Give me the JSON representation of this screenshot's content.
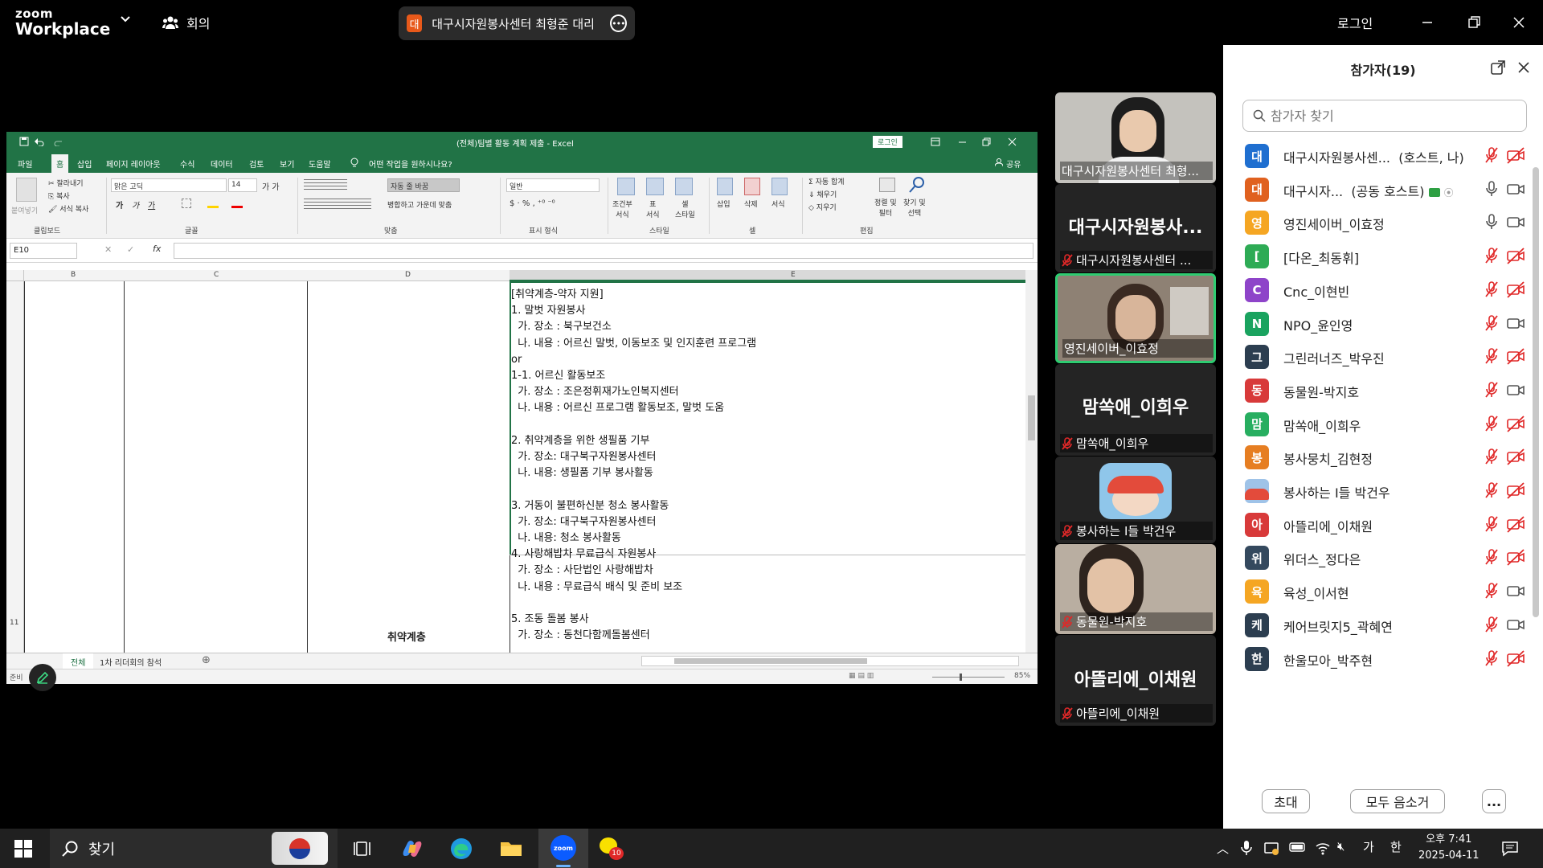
{
  "zoom": {
    "logo_line1": "zoom",
    "logo_line2": "Workplace",
    "meeting_label": "회의",
    "meeting_pill": {
      "avatar_char": "대",
      "title": "대구시자원봉사센터 최형준 대리"
    },
    "login": "로그인"
  },
  "excel": {
    "title": "(전체)팀별 활동 계획 제출  -  Excel",
    "login": "로그인",
    "tabs": [
      "파일",
      "홈",
      "삽입",
      "페이지 레이아웃",
      "수식",
      "데이터",
      "검토",
      "보기",
      "도움말"
    ],
    "tell_me": "어떤 작업을 원하시나요?",
    "share": "공유",
    "ribbon": {
      "clipboard": {
        "paste": "붙여넣기",
        "cut": "잘라내기",
        "copy": "복사",
        "format_painter": "서식 복사",
        "group": "클립보드"
      },
      "font": {
        "name": "맑은 고딕",
        "size": "14",
        "group": "글꼴"
      },
      "align": {
        "wrap": "자동 줄 바꿈",
        "merge": "병합하고 가운데 맞춤",
        "group": "맞춤"
      },
      "number": {
        "format": "일반",
        "group": "표시 형식"
      },
      "styles": {
        "cond": "조건부\n서식",
        "table": "표\n서식",
        "cell": "셀\n스타일",
        "group": "스타일"
      },
      "cells": {
        "insert": "삽입",
        "delete": "삭제",
        "format": "서식",
        "group": "셀"
      },
      "editing": {
        "autosum": "자동 합계",
        "fill": "채우기",
        "clear": "지우기",
        "sort": "정렬 및\n필터",
        "find": "찾기 및\n선택",
        "group": "편집"
      }
    },
    "name_box": "E10",
    "columns": [
      "B",
      "C",
      "D",
      "E"
    ],
    "row_number": "11",
    "cell_d": "취약계층",
    "cell_e": "[취약계층-약자 지원]\n1. 말벗 자원봉사\n  가. 장소 : 북구보건소\n  나. 내용 : 어르신 말벗, 이동보조 및 인지훈련 프로그램\nor\n1-1. 어르신 활동보조\n  가. 장소 : 조은정휘재가노인복지센터\n  나. 내용 : 어르신 프로그램 활동보조, 말벗 도움\n\n2. 취약계층을 위한 생필품 기부\n  가. 장소: 대구북구자원봉사센터\n  나. 내용: 생필품 기부 봉사활동\n\n3. 거동이 불편하신분 청소 봉사활동\n  가. 장소: 대구북구자원봉사센터\n  나. 내용: 청소 봉사활동\n4. 사랑해밥차 무료급식 자원봉사\n  가. 장소 : 사단법인 사랑해밥차\n  나. 내용 : 무료급식 배식 및 준비 보조\n\n5. 조동 돌봄 봉사\n  가. 장소 : 동천다함께돌봄센터",
    "sheets": [
      "전체",
      "1차 리더회의 참석"
    ],
    "status_ready": "준비",
    "zoom_level": "85%"
  },
  "video_tiles": [
    {
      "name": "대구시자원봉사센터 최형...",
      "big": "",
      "muted": false
    },
    {
      "name": "대구시자원봉사센터 ...",
      "big": "대구시자원봉사...",
      "muted": true
    },
    {
      "name": "영진세이버_이효정",
      "big": "",
      "muted": false
    },
    {
      "name": "맘쏙애_이희우",
      "big": "맘쏙애_이희우",
      "muted": true
    },
    {
      "name": "봉사하는 I들 박건우",
      "big": "",
      "muted": true
    },
    {
      "name": "동물원-박지호",
      "big": "",
      "muted": true
    },
    {
      "name": "아뜰리에_이채원",
      "big": "아뜰리에_이채원",
      "muted": true
    }
  ],
  "participants": {
    "title": "참가자(19)",
    "search_placeholder": "참가자 찾기",
    "items": [
      {
        "avatar": "대",
        "color": "#1f6fd0",
        "name": "대구시자원봉사센...",
        "role": "(호스트, 나)",
        "mic": "muted",
        "cam": "off"
      },
      {
        "avatar": "대",
        "color": "#e0611f",
        "name": "대구시자...",
        "role": "(공동 호스트)",
        "mic": "on",
        "cam": "on"
      },
      {
        "avatar": "영",
        "color": "#f5a623",
        "name": "영진세이버_이효정",
        "role": "",
        "mic": "on",
        "cam": "on"
      },
      {
        "avatar": "[",
        "color": "#2eab55",
        "name": "[다온_최동휘]",
        "role": "",
        "mic": "muted",
        "cam": "off"
      },
      {
        "avatar": "C",
        "color": "#8e44c9",
        "name": "Cnc_이현빈",
        "role": "",
        "mic": "muted",
        "cam": "off"
      },
      {
        "avatar": "N",
        "color": "#1aa35f",
        "name": "NPO_윤인영",
        "role": "",
        "mic": "muted",
        "cam": "on"
      },
      {
        "avatar": "그",
        "color": "#2c3e50",
        "name": "그린러너즈_박우진",
        "role": "",
        "mic": "muted",
        "cam": "off"
      },
      {
        "avatar": "동",
        "color": "#d83a3a",
        "name": "동물원-박지호",
        "role": "",
        "mic": "muted",
        "cam": "on"
      },
      {
        "avatar": "맘",
        "color": "#27ae60",
        "name": "맘쏙애_이희우",
        "role": "",
        "mic": "muted",
        "cam": "off"
      },
      {
        "avatar": "봉",
        "color": "#e67e22",
        "name": "봉사뭉치_김현정",
        "role": "",
        "mic": "muted",
        "cam": "off"
      },
      {
        "avatar": "img",
        "color": "#9fc3e8",
        "name": "봉사하는 I들 박건우",
        "role": "",
        "mic": "muted",
        "cam": "off"
      },
      {
        "avatar": "아",
        "color": "#d83a3a",
        "name": "아뜰리에_이채원",
        "role": "",
        "mic": "muted",
        "cam": "off"
      },
      {
        "avatar": "위",
        "color": "#34495e",
        "name": "위더스_정다은",
        "role": "",
        "mic": "muted",
        "cam": "off"
      },
      {
        "avatar": "육",
        "color": "#f5a623",
        "name": "육성_이서현",
        "role": "",
        "mic": "muted",
        "cam": "on"
      },
      {
        "avatar": "케",
        "color": "#2c3e50",
        "name": "케어브릿지5_곽혜연",
        "role": "",
        "mic": "muted",
        "cam": "on"
      },
      {
        "avatar": "한",
        "color": "#2c3e50",
        "name": "한울모아_박주현",
        "role": "",
        "mic": "muted",
        "cam": "off"
      }
    ],
    "invite": "초대",
    "mute_all": "모두 음소거",
    "more": "..."
  },
  "taskbar": {
    "search": "찾기",
    "ime1": "가",
    "ime2": "한",
    "time": "오후 7:41",
    "date": "2025-04-11",
    "chat_badge": "10"
  },
  "colors": {
    "excel_green": "#217346",
    "zoom_blue": "#0b5cff",
    "muted_red": "#e02828",
    "active_green": "#2ecc71"
  }
}
